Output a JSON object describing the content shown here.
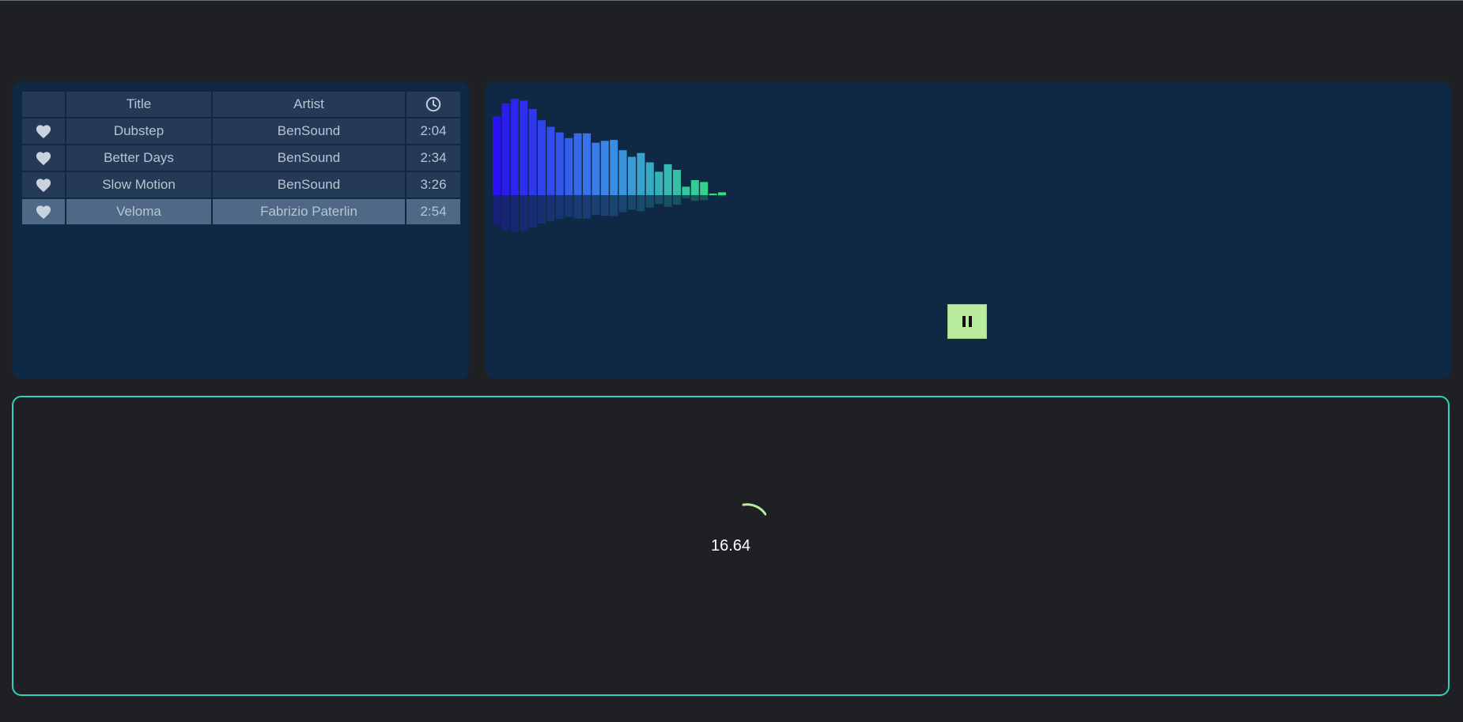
{
  "playlist": {
    "columns": {
      "favorite": "",
      "title": "Title",
      "artist": "Artist",
      "duration_icon": "clock-icon"
    },
    "tracks": [
      {
        "title": "Dubstep",
        "artist": "BenSound",
        "duration": "2:04",
        "active": false
      },
      {
        "title": "Better Days",
        "artist": "BenSound",
        "duration": "2:34",
        "active": false
      },
      {
        "title": "Slow Motion",
        "artist": "BenSound",
        "duration": "3:26",
        "active": false
      },
      {
        "title": "Veloma",
        "artist": "Fabrizio Paterlin",
        "duration": "2:54",
        "active": true
      }
    ]
  },
  "visualizer": {
    "bar_levels": [
      84,
      98,
      103,
      101,
      92,
      80,
      73,
      67,
      61,
      66,
      66,
      56,
      58,
      59,
      48,
      41,
      45,
      35,
      25,
      33,
      27,
      9,
      16,
      14,
      0,
      3
    ],
    "max_level": 103,
    "color_start": "#2a12f0",
    "color_mid": "#3a8ae8",
    "color_end": "#33e07a",
    "playback_state": "playing",
    "pause_button_icon": "pause-icon",
    "button_color": "#b9eb9d"
  },
  "timer": {
    "value": "16.64",
    "spinner_color": "#b9eb9d",
    "border_color": "#2fd2ba"
  }
}
